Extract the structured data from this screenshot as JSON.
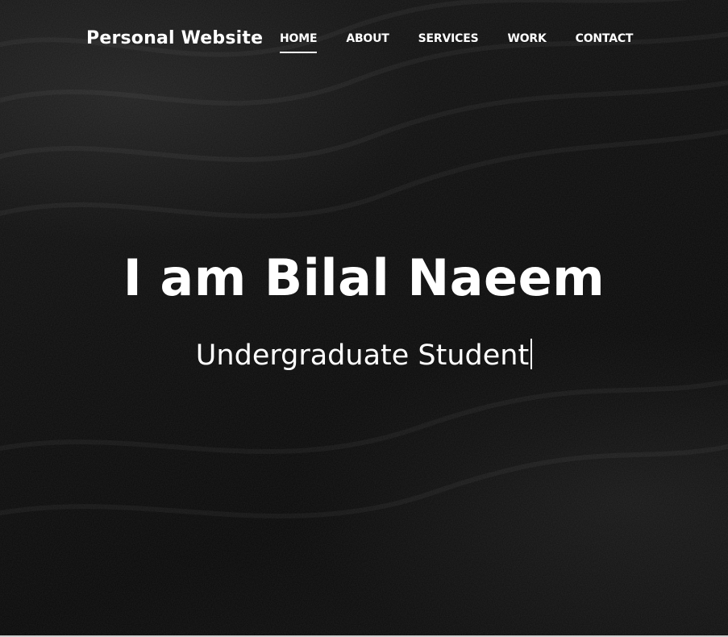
{
  "brand": {
    "title": "Personal Website"
  },
  "nav": {
    "items": [
      {
        "label": "HOME",
        "active": true
      },
      {
        "label": "ABOUT",
        "active": false
      },
      {
        "label": "SERVICES",
        "active": false
      },
      {
        "label": "WORK",
        "active": false
      },
      {
        "label": "CONTACT",
        "active": false
      }
    ]
  },
  "hero": {
    "headline": "I am Bilal Naeem",
    "subline": "Undergraduate Student"
  },
  "colors": {
    "background": "#0a0a0a",
    "text": "#ffffff",
    "accent_underline": "#ffffff"
  }
}
